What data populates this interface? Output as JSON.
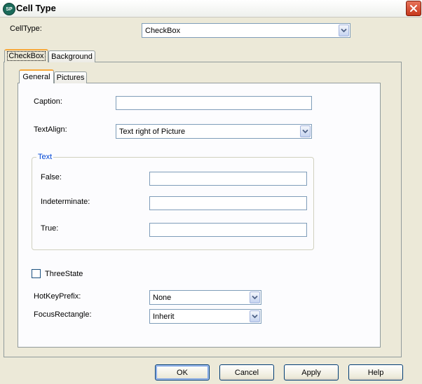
{
  "window": {
    "title": "Cell Type",
    "icon_label": "SP"
  },
  "celltype": {
    "label": "CellType:",
    "value": "CheckBox"
  },
  "outer_tabs": [
    {
      "label": "CheckBox",
      "active": true
    },
    {
      "label": "Background",
      "active": false
    }
  ],
  "inner_tabs": [
    {
      "label": "General",
      "active": true
    },
    {
      "label": "Pictures",
      "active": false
    }
  ],
  "general": {
    "caption_label": "Caption:",
    "caption_value": "",
    "textalign_label": "TextAlign:",
    "textalign_value": "Text right of Picture",
    "text_group": {
      "legend": "Text",
      "false_label": "False:",
      "false_value": "",
      "indeterminate_label": "Indeterminate:",
      "indeterminate_value": "",
      "true_label": "True:",
      "true_value": ""
    },
    "threestate_label": "ThreeState",
    "threestate_checked": false,
    "hotkeyprefix_label": "HotKeyPrefix:",
    "hotkeyprefix_value": "None",
    "focusrect_label": "FocusRectangle:",
    "focusrect_value": "Inherit"
  },
  "buttons": {
    "ok": "OK",
    "cancel": "Cancel",
    "apply": "Apply",
    "help": "Help"
  },
  "colors": {
    "dialog_bg": "#ece9d8",
    "panel_bg": "#fcfcfe",
    "active_tab_accent": "#f7a93b",
    "group_legend": "#0046d5",
    "close_button": "#c6381c"
  }
}
